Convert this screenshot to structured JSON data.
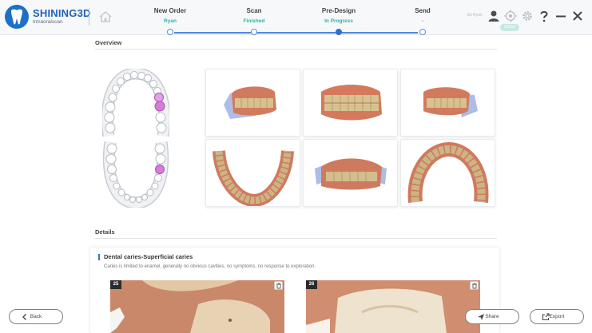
{
  "app": {
    "brand": "SHINING3D",
    "subtitle": "Intraoralscan"
  },
  "steps": [
    {
      "title": "New Order",
      "sub": "Ryan",
      "state": "done"
    },
    {
      "title": "Scan",
      "sub": "Finished",
      "state": "done"
    },
    {
      "title": "Pre-Design",
      "sub": "In Progress",
      "state": "active"
    },
    {
      "title": "Send",
      "sub": "-",
      "state": "pending"
    }
  ],
  "toolbar": {
    "user_label": "Eli Ryan",
    "badge_label": "Online",
    "icons": [
      "home-icon",
      "user-icon",
      "crosshair-icon",
      "gear-icon",
      "help-icon",
      "minimize-icon",
      "close-icon"
    ]
  },
  "overview": {
    "title": "Overview",
    "views": [
      "Upper right view",
      "Frontal view",
      "Upper left view",
      "Lower jaw view",
      "Occlusal view",
      "Upper jaw view"
    ]
  },
  "details": {
    "title": "Details",
    "finding": {
      "title": "Dental caries-Superficial  caries",
      "description": "Caries is limited to enamel, generally no obvious cavities, no symptoms, no response to exploration.",
      "teeth": [
        "25",
        "26"
      ]
    }
  },
  "buttons": {
    "back": "Back",
    "share": "Share",
    "export": "Export"
  },
  "colors": {
    "brand": "#1d62b8",
    "accent": "#2e6fd1",
    "status_green": "#26b4a2",
    "caries_marker": "#cc66cc"
  }
}
